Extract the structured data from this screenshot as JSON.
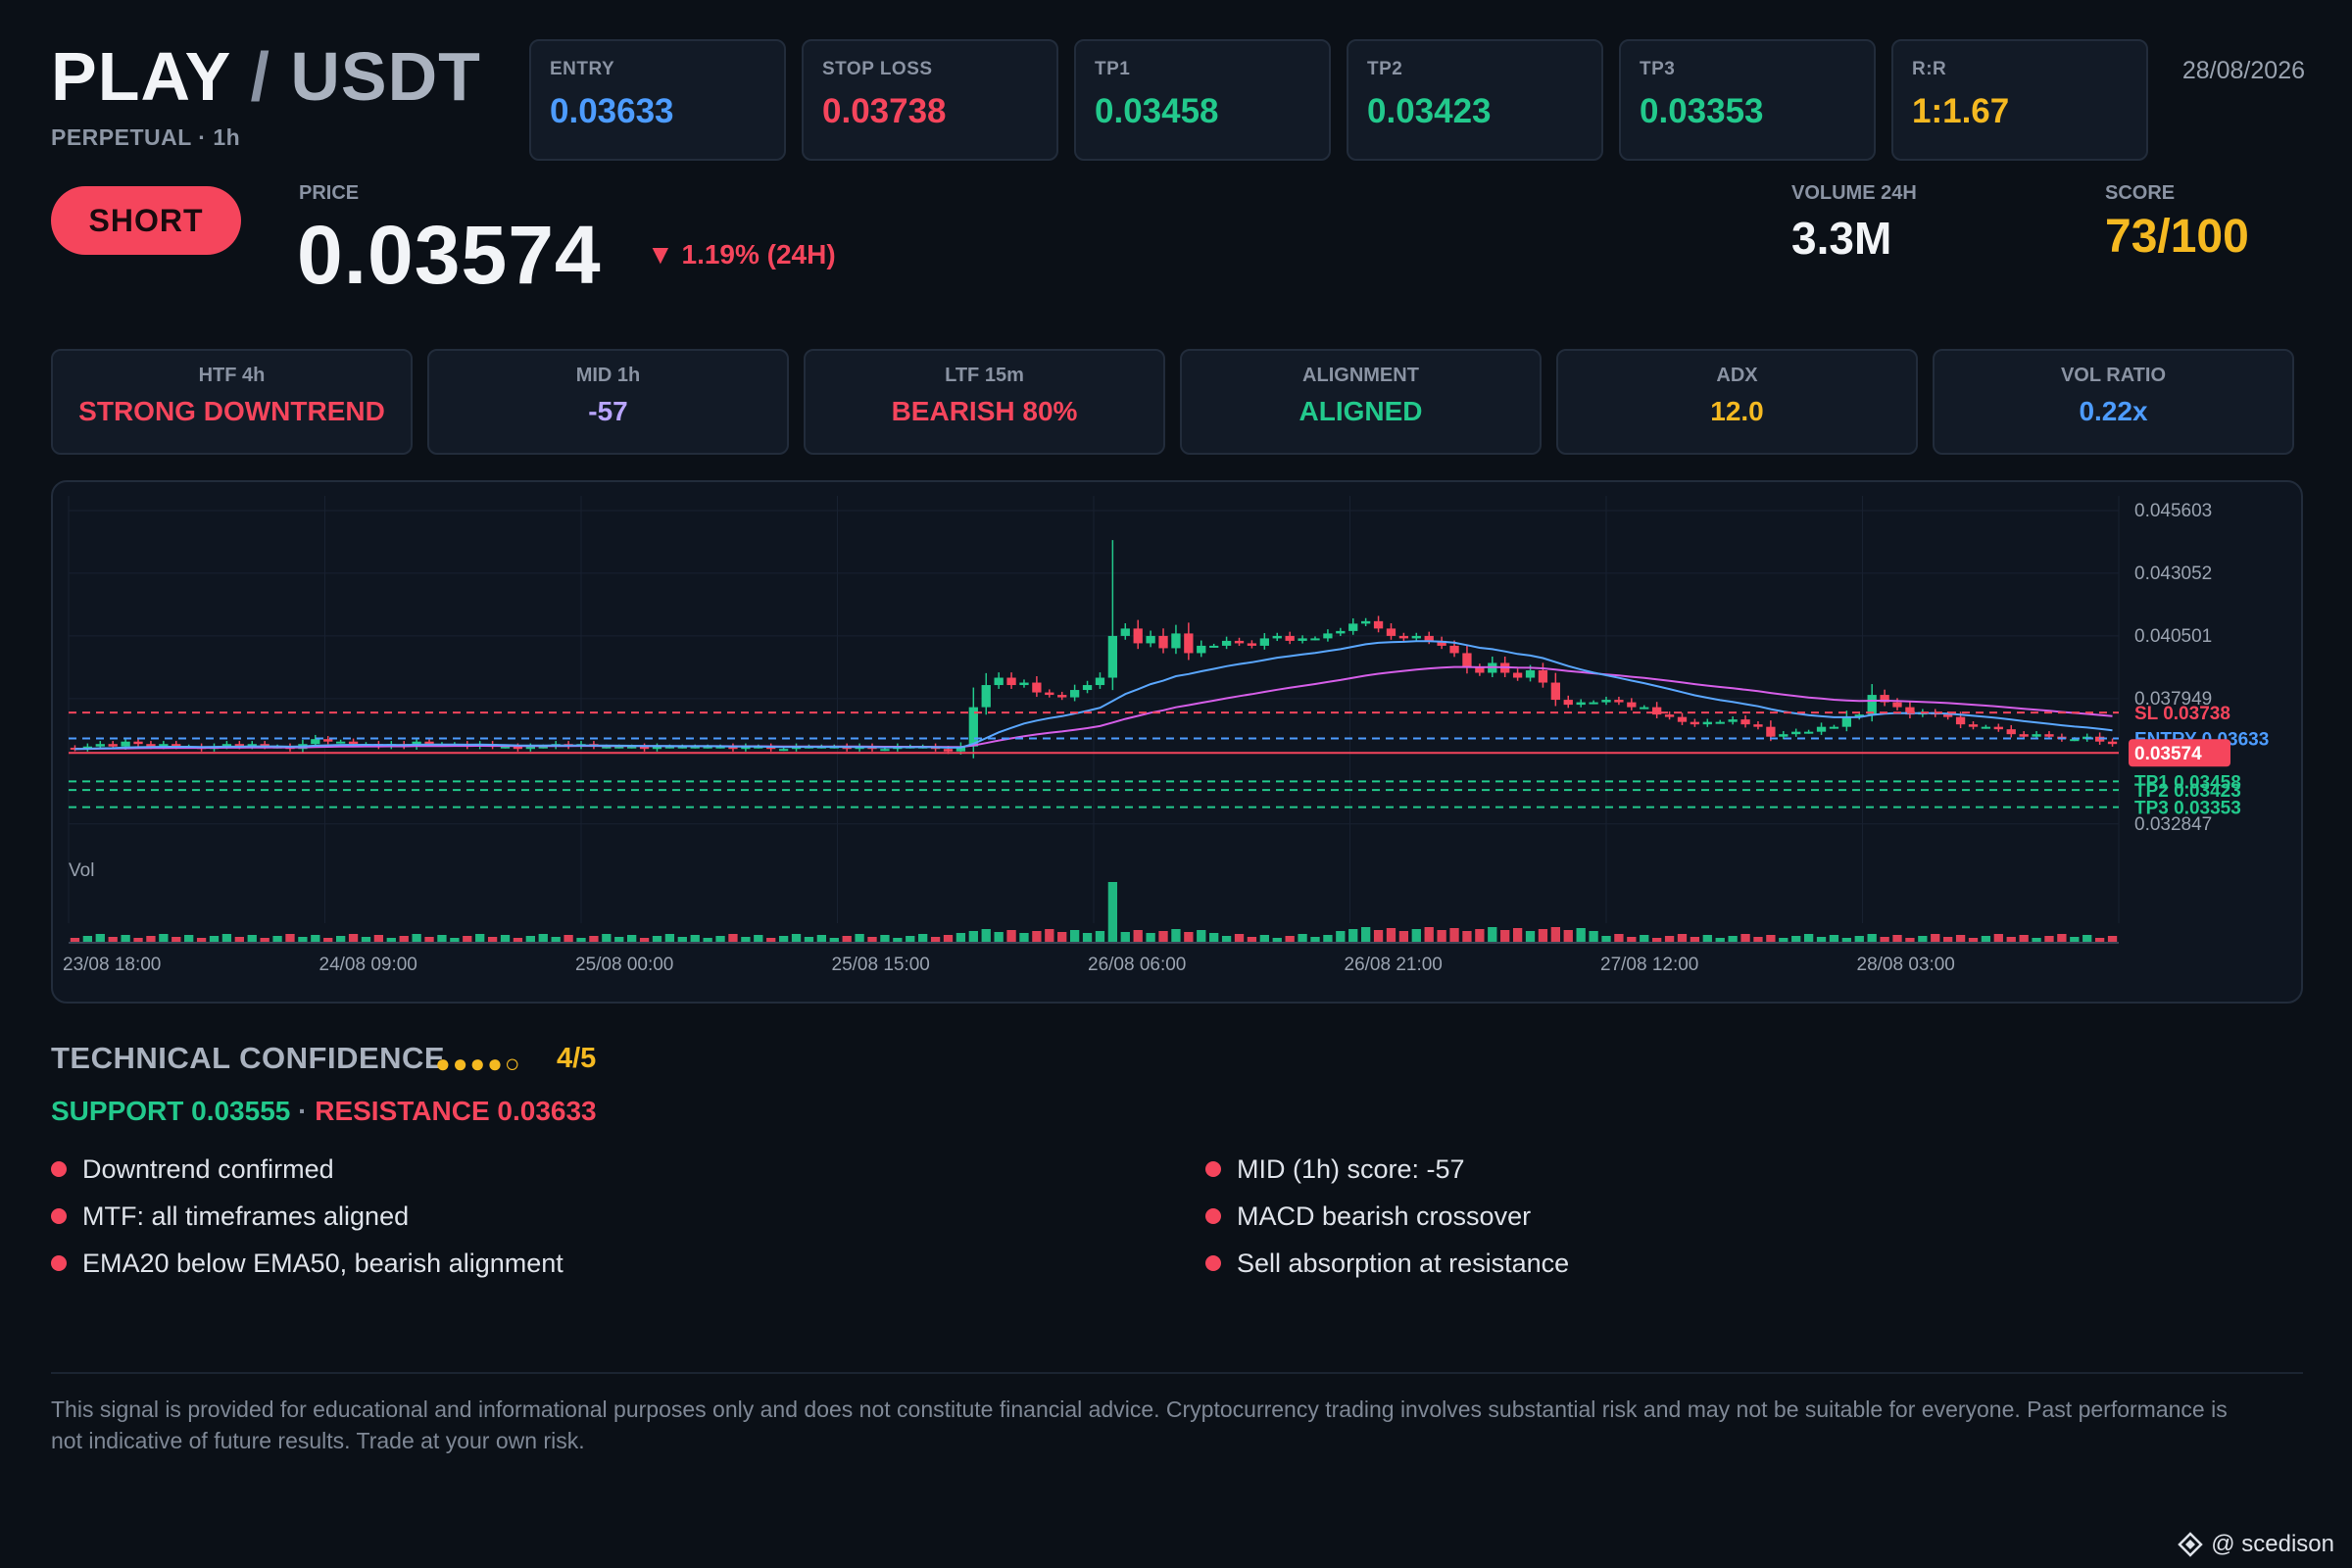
{
  "header": {
    "base": "PLAY",
    "separator": "/",
    "quote": "USDT",
    "subtitle": "PERPETUAL · 1h",
    "date": "28/08/2026"
  },
  "levels": [
    {
      "label": "ENTRY",
      "value": "0.03633",
      "color": "#4d9cff"
    },
    {
      "label": "STOP LOSS",
      "value": "0.03738",
      "color": "#f5455c"
    },
    {
      "label": "TP1",
      "value": "0.03458",
      "color": "#22c98c"
    },
    {
      "label": "TP2",
      "value": "0.03423",
      "color": "#22c98c"
    },
    {
      "label": "TP3",
      "value": "0.03353",
      "color": "#22c98c"
    },
    {
      "label": "R:R",
      "value": "1:1.67",
      "color": "#f5b921"
    }
  ],
  "signal": {
    "direction": "SHORT",
    "color": "#f5455c"
  },
  "price": {
    "label": "PRICE",
    "value": "0.03574",
    "change": "▼ 1.19% (24H)"
  },
  "volume": {
    "label": "VOLUME 24H",
    "value": "3.3M"
  },
  "score": {
    "label": "SCORE",
    "value": "73/100"
  },
  "stats": [
    {
      "label": "HTF 4h",
      "value": "STRONG DOWNTREND",
      "color": "#f5455c"
    },
    {
      "label": "MID 1h",
      "value": "-57",
      "color": "#b9a5ff"
    },
    {
      "label": "LTF 15m",
      "value": "BEARISH 80%",
      "color": "#f5455c"
    },
    {
      "label": "ALIGNMENT",
      "value": "ALIGNED",
      "color": "#22c98c"
    },
    {
      "label": "ADX",
      "value": "12.0",
      "color": "#f5b921"
    },
    {
      "label": "VOL RATIO",
      "value": "0.22x",
      "color": "#4d9cff"
    }
  ],
  "chart_data": {
    "type": "candlestick",
    "y_ticks": [
      "0.045603",
      "0.043052",
      "0.040501",
      "0.037949",
      "0.032847"
    ],
    "ylim": [
      0.032,
      0.0462
    ],
    "x_ticks": [
      "23/08 18:00",
      "24/08 09:00",
      "25/08 00:00",
      "25/08 15:00",
      "26/08 06:00",
      "26/08 21:00",
      "27/08 12:00",
      "28/08 03:00"
    ],
    "volume_label": "Vol",
    "close_path": [
      0.0359,
      0.036,
      0.0361,
      0.036,
      0.0362,
      0.0361,
      0.036,
      0.0361,
      0.036,
      0.036,
      0.0359,
      0.036,
      0.0361,
      0.036,
      0.0361,
      0.036,
      0.036,
      0.0359,
      0.0361,
      0.0363,
      0.0362,
      0.0362,
      0.0361,
      0.0361,
      0.036,
      0.0361,
      0.036,
      0.0362,
      0.0361,
      0.0361,
      0.0361,
      0.036,
      0.0361,
      0.036,
      0.036,
      0.0359,
      0.036,
      0.036,
      0.0361,
      0.036,
      0.0361,
      0.036,
      0.036,
      0.036,
      0.036,
      0.0359,
      0.036,
      0.036,
      0.036,
      0.036,
      0.036,
      0.036,
      0.0359,
      0.036,
      0.036,
      0.0359,
      0.0359,
      0.036,
      0.036,
      0.036,
      0.036,
      0.0359,
      0.036,
      0.0359,
      0.0359,
      0.036,
      0.036,
      0.036,
      0.0359,
      0.0358,
      0.036,
      0.0376,
      0.0385,
      0.0388,
      0.0385,
      0.0386,
      0.0382,
      0.0381,
      0.038,
      0.0383,
      0.0385,
      0.0388,
      0.0405,
      0.0408,
      0.0402,
      0.0405,
      0.04,
      0.0406,
      0.0398,
      0.0401,
      0.0401,
      0.0403,
      0.0402,
      0.0401,
      0.0404,
      0.0405,
      0.0403,
      0.0404,
      0.0404,
      0.0406,
      0.0407,
      0.041,
      0.0411,
      0.0408,
      0.0405,
      0.0404,
      0.0405,
      0.0403,
      0.0401,
      0.0398,
      0.0392,
      0.039,
      0.0394,
      0.039,
      0.0388,
      0.0391,
      0.0386,
      0.0379,
      0.0377,
      0.0378,
      0.0378,
      0.0379,
      0.0378,
      0.0376,
      0.0376,
      0.0373,
      0.0372,
      0.037,
      0.0369,
      0.037,
      0.037,
      0.0371,
      0.0369,
      0.0368,
      0.0364,
      0.0365,
      0.0366,
      0.0366,
      0.0368,
      0.0368,
      0.0372,
      0.0373,
      0.0381,
      0.0378,
      0.0376,
      0.0373,
      0.0374,
      0.0373,
      0.0372,
      0.0369,
      0.0368,
      0.0368,
      0.0367,
      0.0365,
      0.0364,
      0.0365,
      0.0364,
      0.0363,
      0.0363,
      0.0364,
      0.0362,
      0.0361
    ],
    "price_lines": [
      {
        "label": "SL 0.03738",
        "value": 0.03738,
        "color": "#f5455c"
      },
      {
        "label": "ENTRY 0.03633",
        "value": 0.03633,
        "color": "#4d9cff"
      },
      {
        "label": "0.03574",
        "value": 0.03574,
        "color": "#f5455c",
        "current": true
      },
      {
        "label": "TP1 0.03458",
        "value": 0.03458,
        "color": "#22c98c"
      },
      {
        "label": "TP2 0.03423",
        "value": 0.03423,
        "color": "#22c98c"
      },
      {
        "label": "TP3 0.03353",
        "value": 0.03353,
        "color": "#22c98c"
      }
    ],
    "series": [
      {
        "name": "EMA20",
        "color": "#5aa7ff"
      },
      {
        "name": "EMA50",
        "color": "#d55ee8"
      }
    ]
  },
  "confidence": {
    "title": "TECHNICAL CONFIDENCE",
    "dots": "●●●●○",
    "score": "4/5",
    "support": "SUPPORT 0.03555",
    "separator": "·",
    "resistance": "RESISTANCE 0.03633"
  },
  "reasons_left": [
    "Downtrend confirmed",
    "MTF: all timeframes aligned",
    "EMA20 below EMA50, bearish alignment"
  ],
  "reasons_right": [
    "MID (1h) score: -57",
    "MACD bearish crossover",
    "Sell absorption at resistance"
  ],
  "disclaimer": "This signal is provided for educational and informational purposes only and does not constitute financial advice. Cryptocurrency trading involves substantial risk and may not be suitable for everyone. Past performance is not indicative of future results. Trade at your own risk.",
  "watermark": "@ scedison"
}
